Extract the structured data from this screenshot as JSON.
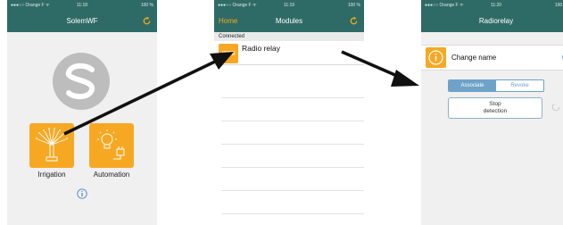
{
  "screens": [
    {
      "status": {
        "carrier": "●●●○○ Orange F ᯤ",
        "time": "11:18",
        "battery": "100 %"
      },
      "nav": {
        "title": "SolemWF"
      },
      "tiles": [
        {
          "label": "Irrigation"
        },
        {
          "label": "Automation"
        }
      ]
    },
    {
      "status": {
        "carrier": "●●●○○ Orange F ᯤ",
        "time": "11:19",
        "battery": "100 %"
      },
      "nav": {
        "title": "Modules",
        "left": "Home"
      },
      "section": "Connected",
      "modules": [
        {
          "badge": "((RM))",
          "name": "Radio relay"
        }
      ]
    },
    {
      "status": {
        "carrier": "●●●○○ Orange F ᯤ",
        "time": "11:20",
        "battery": "100 %"
      },
      "nav": {
        "title": "Radiorelay"
      },
      "change_name": "Change name",
      "segments": [
        "Associate",
        "Revoke"
      ],
      "stop_button": [
        "Stop",
        "detection"
      ]
    }
  ],
  "colors": {
    "header": "#2f6b66",
    "accent": "#f7a823",
    "segment": "#6ea2c9"
  }
}
